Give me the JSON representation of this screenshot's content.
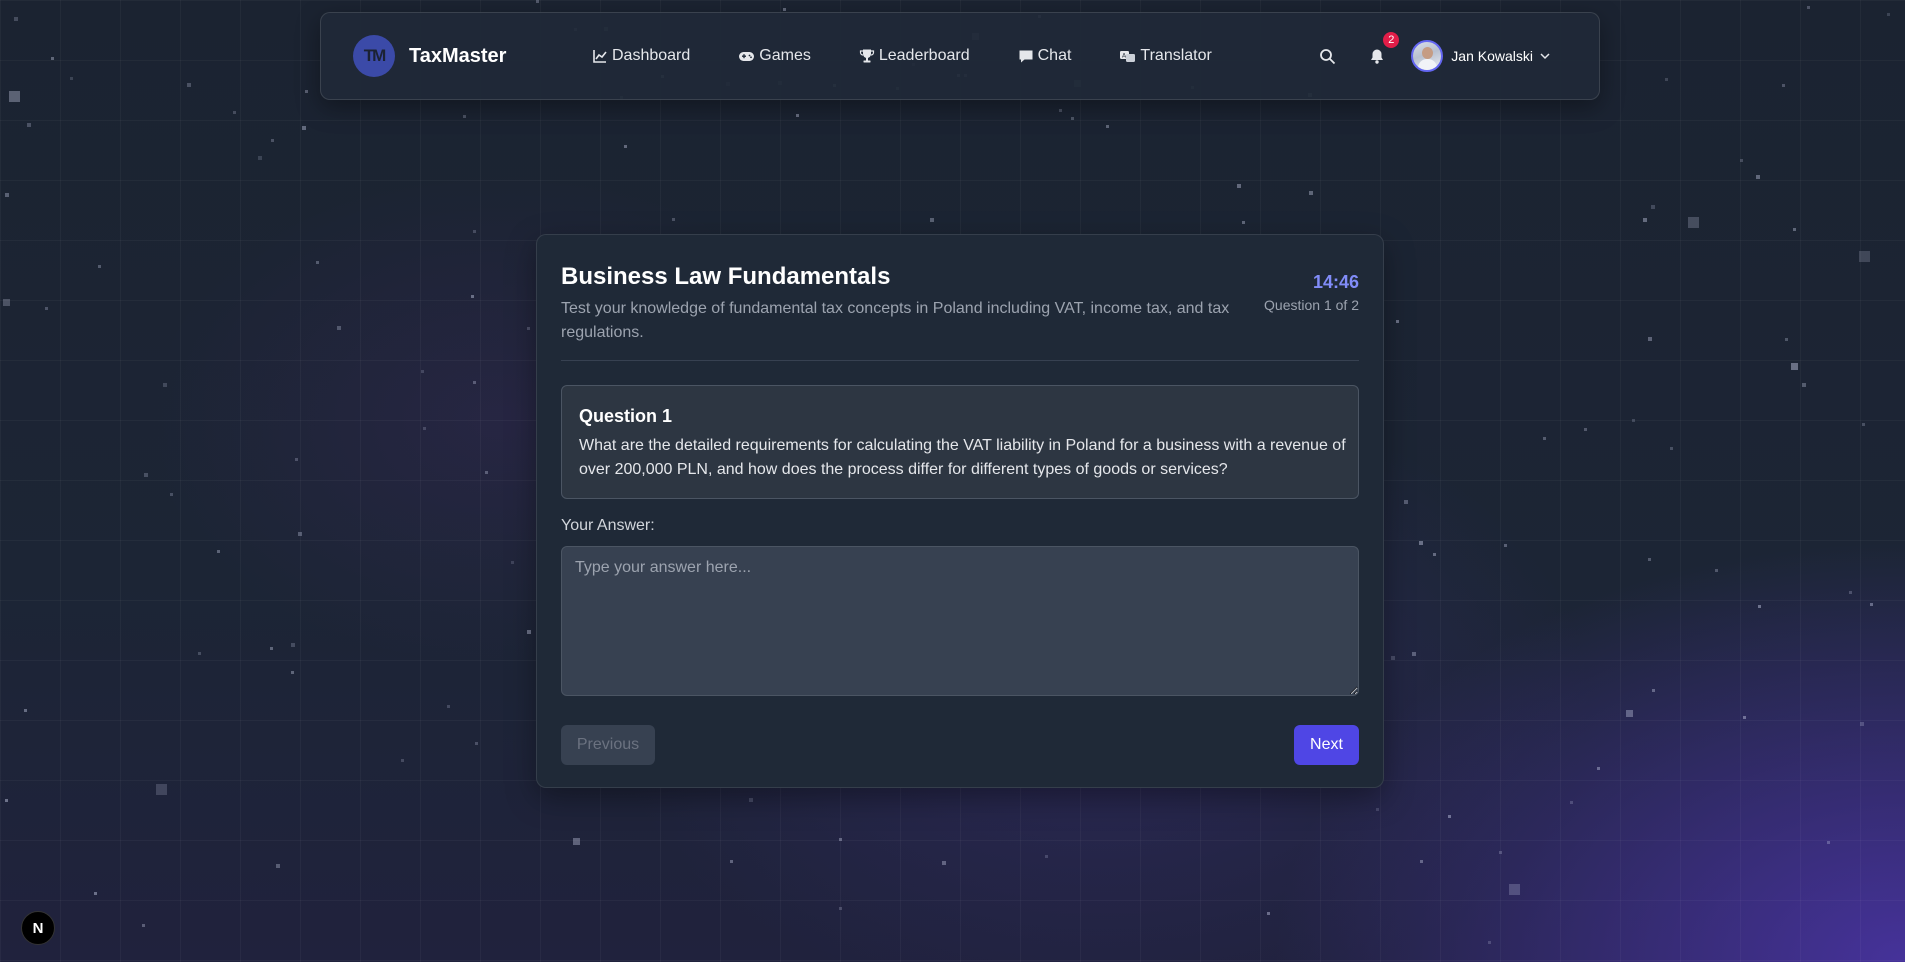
{
  "app": {
    "name": "TaxMaster",
    "logo_initials": "TM"
  },
  "nav": {
    "links": [
      {
        "label": "Dashboard",
        "icon": "chart-line-icon"
      },
      {
        "label": "Games",
        "icon": "gamepad-icon"
      },
      {
        "label": "Leaderboard",
        "icon": "trophy-icon"
      },
      {
        "label": "Chat",
        "icon": "chat-bubble-icon"
      },
      {
        "label": "Translator",
        "icon": "translator-icon"
      }
    ],
    "notification_count": "2",
    "user_name": "Jan Kowalski"
  },
  "quiz": {
    "title": "Business Law Fundamentals",
    "description": "Test your knowledge of fundamental tax concepts in Poland including VAT, income tax, and tax regulations.",
    "timer": "14:46",
    "progress": "Question 1 of 2",
    "question_heading": "Question 1",
    "question_text": "What are the detailed requirements for calculating the VAT liability in Poland for a business with a revenue of over 200,000 PLN, and how does the process differ for different types of goods or services?",
    "answer_label": "Your Answer:",
    "answer_placeholder": "Type your answer here...",
    "answer_value": "",
    "previous_label": "Previous",
    "next_label": "Next"
  },
  "dev_badge": {
    "letter": "N"
  },
  "colors": {
    "accent": "#4f46e5",
    "timer": "#818cf8",
    "card_bg": "#1f2937",
    "badge": "#e11d48"
  }
}
